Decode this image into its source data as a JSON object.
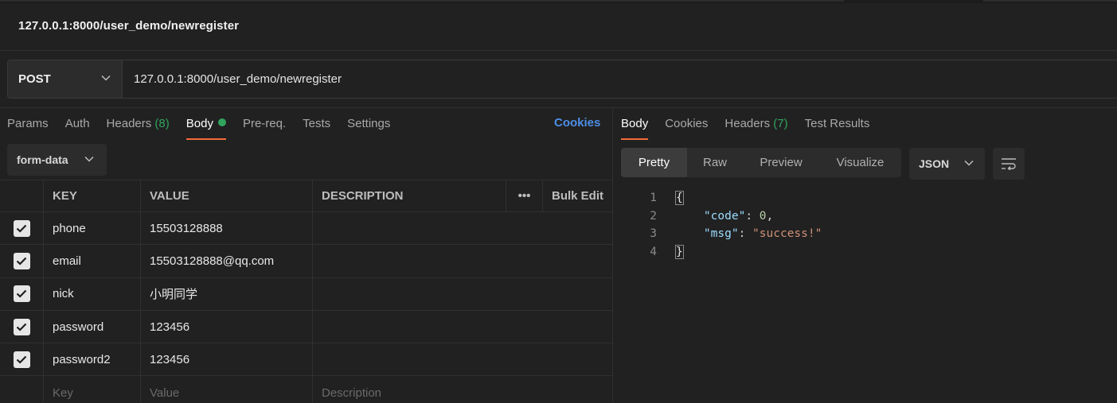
{
  "request": {
    "title": "127.0.0.1:8000/user_demo/newregister",
    "method": "POST",
    "url": "127.0.0.1:8000/user_demo/newregister"
  },
  "request_tabs": [
    {
      "label": "Params"
    },
    {
      "label": "Auth"
    },
    {
      "label": "Headers",
      "count": "(8)"
    },
    {
      "label": "Body",
      "active": true,
      "dot": true
    },
    {
      "label": "Pre-req."
    },
    {
      "label": "Tests"
    },
    {
      "label": "Settings"
    }
  ],
  "cookies_link": "Cookies",
  "body_type": "form-data",
  "table": {
    "headers": {
      "key": "KEY",
      "value": "VALUE",
      "description": "DESCRIPTION",
      "more": "•••",
      "bulk_edit": "Bulk Edit"
    },
    "rows": [
      {
        "checked": true,
        "key": "phone",
        "value": "15503128888",
        "description": ""
      },
      {
        "checked": true,
        "key": "email",
        "value": "15503128888@qq.com",
        "description": ""
      },
      {
        "checked": true,
        "key": "nick",
        "value": "小明同学",
        "description": ""
      },
      {
        "checked": true,
        "key": "password",
        "value": "123456",
        "description": ""
      },
      {
        "checked": true,
        "key": "password2",
        "value": "123456",
        "description": ""
      }
    ],
    "placeholder": {
      "key": "Key",
      "value": "Value",
      "description": "Description"
    }
  },
  "response_tabs": [
    {
      "label": "Body",
      "active": true
    },
    {
      "label": "Cookies"
    },
    {
      "label": "Headers",
      "count": "(7)"
    },
    {
      "label": "Test Results"
    }
  ],
  "view_modes": [
    "Pretty",
    "Raw",
    "Preview",
    "Visualize"
  ],
  "active_view": "Pretty",
  "format": "JSON",
  "response_code": [
    {
      "num": "1",
      "text": "{"
    },
    {
      "num": "2",
      "key": "\"code\"",
      "value": "0"
    },
    {
      "num": "3",
      "key": "\"msg\"",
      "value": "\"success!\""
    },
    {
      "num": "4",
      "text": "}"
    }
  ],
  "colors": {
    "accent_tab": "#f26b3a",
    "count_green": "#31a45d",
    "link_blue": "#4d8fe8"
  },
  "icons": {
    "method_dropdown": "chevron-down-icon",
    "body_type_dropdown": "chevron-down-icon",
    "format_dropdown": "chevron-down-icon",
    "wrap": "wrap-lines-icon",
    "checkbox": "checkmark-icon"
  }
}
